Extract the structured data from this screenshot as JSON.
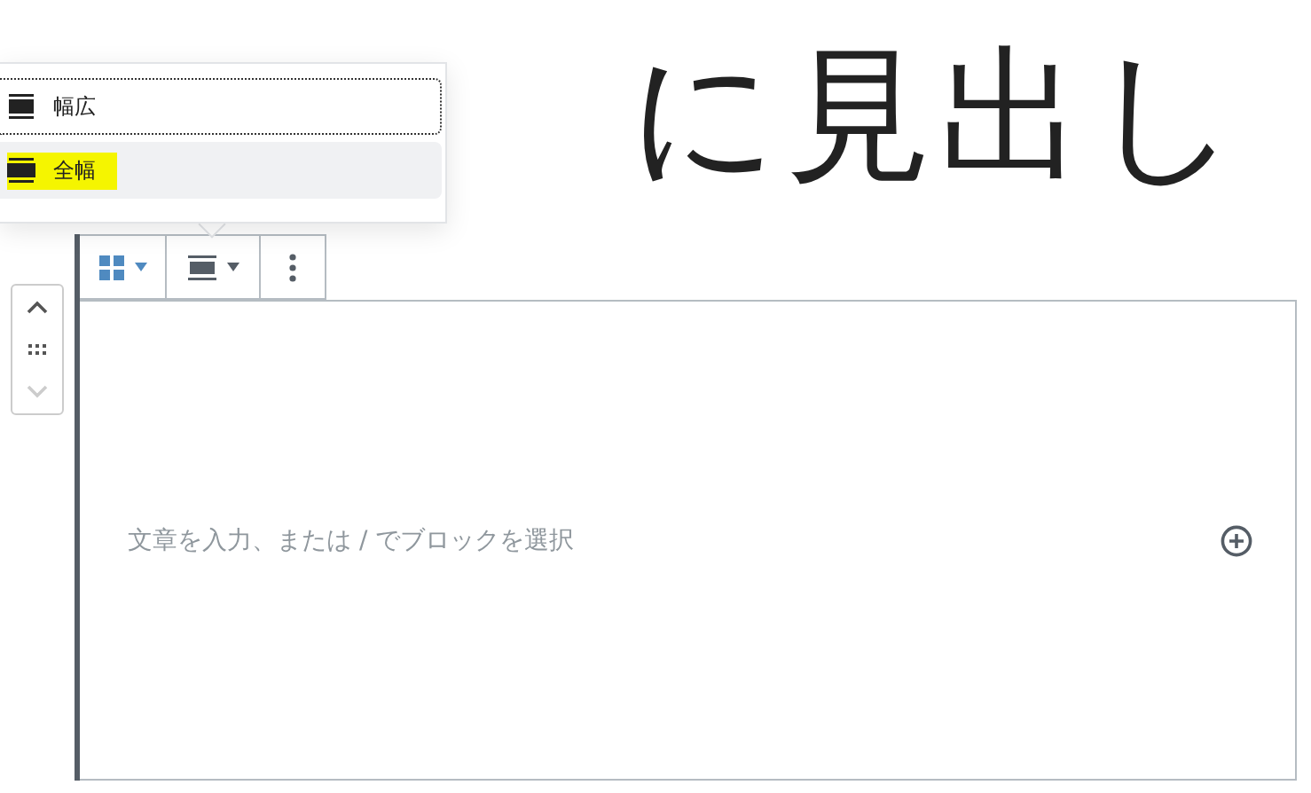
{
  "heading": {
    "text": "に見出し"
  },
  "align_menu": {
    "items": [
      {
        "label": "幅広",
        "kind": "wide",
        "selected": false,
        "focused": true,
        "highlighted": false
      },
      {
        "label": "全幅",
        "kind": "full",
        "selected": true,
        "focused": false,
        "highlighted": true
      }
    ]
  },
  "block": {
    "placeholder": "文章を入力、または / でブロックを選択"
  }
}
